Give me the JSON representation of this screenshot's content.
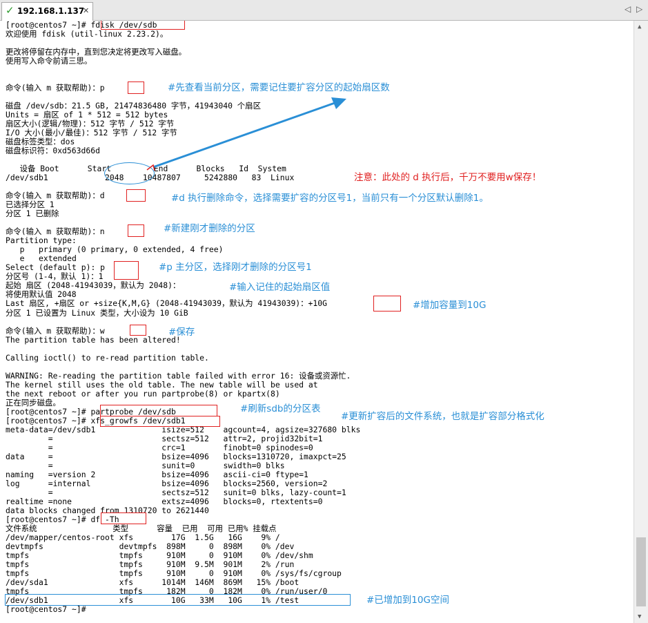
{
  "tab": {
    "title": "192.168.1.137",
    "close": "✕"
  },
  "nav": {
    "prev": "◁",
    "next": "▷"
  },
  "terminal_lines": [
    "[root@centos7 ~]# fdisk /dev/sdb",
    "欢迎使用 fdisk (util-linux 2.23.2)。",
    "",
    "更改将停留在内存中，直到您决定将更改写入磁盘。",
    "使用写入命令前请三思。",
    "",
    "",
    "命令(输入 m 获取帮助)：p",
    "",
    "磁盘 /dev/sdb：21.5 GB, 21474836480 字节，41943040 个扇区",
    "Units = 扇区 of 1 * 512 = 512 bytes",
    "扇区大小(逻辑/物理)：512 字节 / 512 字节",
    "I/O 大小(最小/最佳)：512 字节 / 512 字节",
    "磁盘标签类型：dos",
    "磁盘标识符：0xd563d66d",
    "",
    "   设备 Boot      Start         End      Blocks   Id  System",
    "/dev/sdb1            2048    10487807     5242880   83  Linux",
    "",
    "命令(输入 m 获取帮助)：d",
    "已选择分区 1",
    "分区 1 已删除",
    "",
    "命令(输入 m 获取帮助)：n",
    "Partition type:",
    "   p   primary (0 primary, 0 extended, 4 free)",
    "   e   extended",
    "Select (default p): p",
    "分区号 (1-4，默认 1)：1",
    "起始 扇区 (2048-41943039，默认为 2048)：",
    "将使用默认值 2048",
    "Last 扇区, +扇区 or +size{K,M,G} (2048-41943039，默认为 41943039)：+10G",
    "分区 1 已设置为 Linux 类型，大小设为 10 GiB",
    "",
    "命令(输入 m 获取帮助)：w",
    "The partition table has been altered!",
    "",
    "Calling ioctl() to re-read partition table.",
    "",
    "WARNING: Re-reading the partition table failed with error 16: 设备或资源忙.",
    "The kernel still uses the old table. The new table will be used at",
    "the next reboot or after you run partprobe(8) or kpartx(8)",
    "正在同步磁盘。",
    "[root@centos7 ~]# partprobe /dev/sdb",
    "[root@centos7 ~]# xfs_growfs /dev/sdb1",
    "meta-data=/dev/sdb1              isize=512    agcount=4, agsize=327680 blks",
    "         =                       sectsz=512   attr=2, projid32bit=1",
    "         =                       crc=1        finobt=0 spinodes=0",
    "data     =                       bsize=4096   blocks=1310720, imaxpct=25",
    "         =                       sunit=0      swidth=0 blks",
    "naming   =version 2              bsize=4096   ascii-ci=0 ftype=1",
    "log      =internal               bsize=4096   blocks=2560, version=2",
    "         =                       sectsz=512   sunit=0 blks, lazy-count=1",
    "realtime =none                   extsz=4096   blocks=0, rtextents=0",
    "data blocks changed from 1310720 to 2621440",
    "[root@centos7 ~]# df -Th",
    "文件系统                类型      容量  已用  可用 已用% 挂载点",
    "/dev/mapper/centos-root xfs        17G  1.5G   16G    9% /",
    "devtmpfs                devtmpfs  898M     0  898M    0% /dev",
    "tmpfs                   tmpfs     910M     0  910M    0% /dev/shm",
    "tmpfs                   tmpfs     910M  9.5M  901M    2% /run",
    "tmpfs                   tmpfs     910M     0  910M    0% /sys/fs/cgroup",
    "/dev/sda1               xfs      1014M  146M  869M   15% /boot",
    "tmpfs                   tmpfs     182M     0  182M    0% /run/user/0",
    "/dev/sdb1               xfs        10G   33M   10G    1% /test",
    "[root@centos7 ~]#"
  ],
  "annotations": {
    "note_p": "#先查看当前分区，需要记住要扩容分区的起始扇区数",
    "note_warn": "注意：此处的 d 执行后，千万不要用w保存！",
    "note_d": "#d 执行删除命令，选择需要扩容的分区号1，当前只有一个分区默认删除1。",
    "note_n": "#新建刚才删除的分区",
    "note_pp": "#p 主分区，选择刚才删除的分区号1",
    "note_start": "#输入记住的起始扇区值",
    "note_size": "#增加容量到10G",
    "note_w": "#保存",
    "note_partprobe": "#刷新sdb的分区表",
    "note_xfs": "#更新扩容后的文件系统，也就是扩容部分格式化",
    "note_result": "#已增加到10G空间"
  },
  "colors": {
    "annotation_blue": "#2a8fd6",
    "annotation_red": "#e02020",
    "tab_check": "#2e9b2e"
  }
}
